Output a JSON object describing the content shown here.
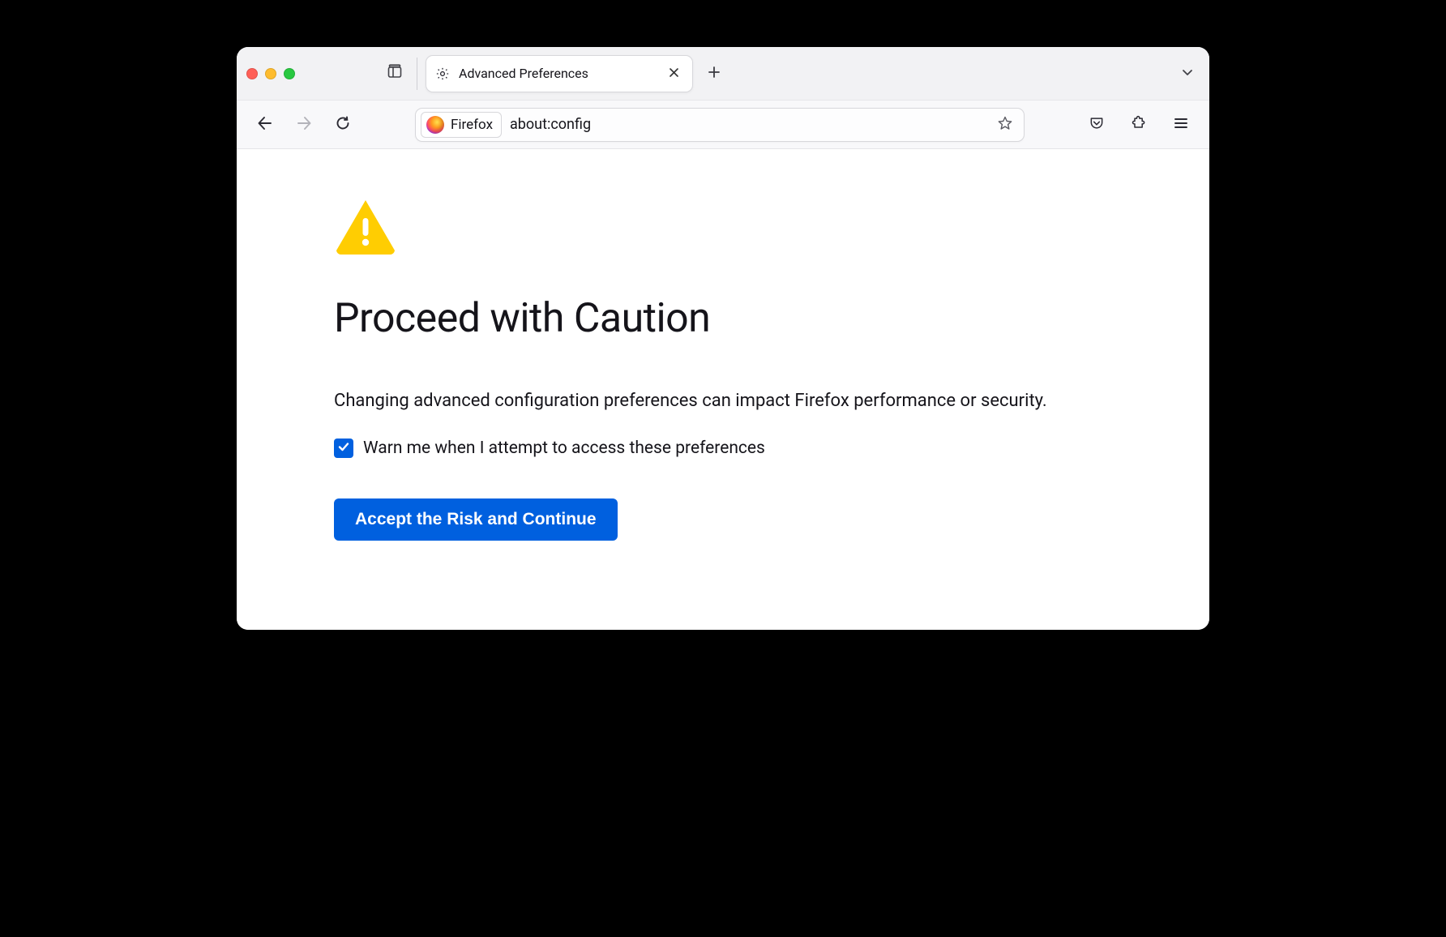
{
  "tabbar": {
    "tab_title": "Advanced Preferences"
  },
  "toolbar": {
    "identity_label": "Firefox",
    "url": "about:config"
  },
  "page": {
    "title": "Proceed with Caution",
    "description": "Changing advanced configuration preferences can impact Firefox performance or security.",
    "checkbox_label": "Warn me when I attempt to access these preferences",
    "checkbox_checked": true,
    "accept_label": "Accept the Risk and Continue"
  },
  "colors": {
    "accent": "#0060df",
    "warn": "#ffcd02"
  }
}
